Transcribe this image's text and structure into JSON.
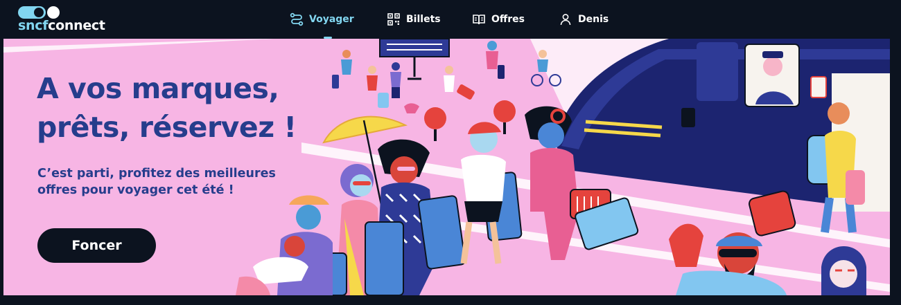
{
  "brand": {
    "part1": "sncf",
    "part2": "connect"
  },
  "nav": {
    "items": [
      {
        "label": "Voyager",
        "icon": "route-icon",
        "active": true
      },
      {
        "label": "Billets",
        "icon": "qr-code-icon",
        "active": false
      },
      {
        "label": "Offres",
        "icon": "book-icon",
        "active": false
      },
      {
        "label": "Denis",
        "icon": "user-icon",
        "active": false
      }
    ]
  },
  "hero": {
    "title_line1": "A vos marques,",
    "title_line2": "prêts, réservez !",
    "subtitle_line1": "C’est parti, profitez des meilleures",
    "subtitle_line2": "offres pour voyager cet été !",
    "cta_label": "Foncer"
  },
  "colors": {
    "background": "#0c131f",
    "accent": "#82d6f0",
    "hero_bg": "#f7b5e4",
    "hero_text": "#263d8c",
    "train": "#1c2470"
  }
}
